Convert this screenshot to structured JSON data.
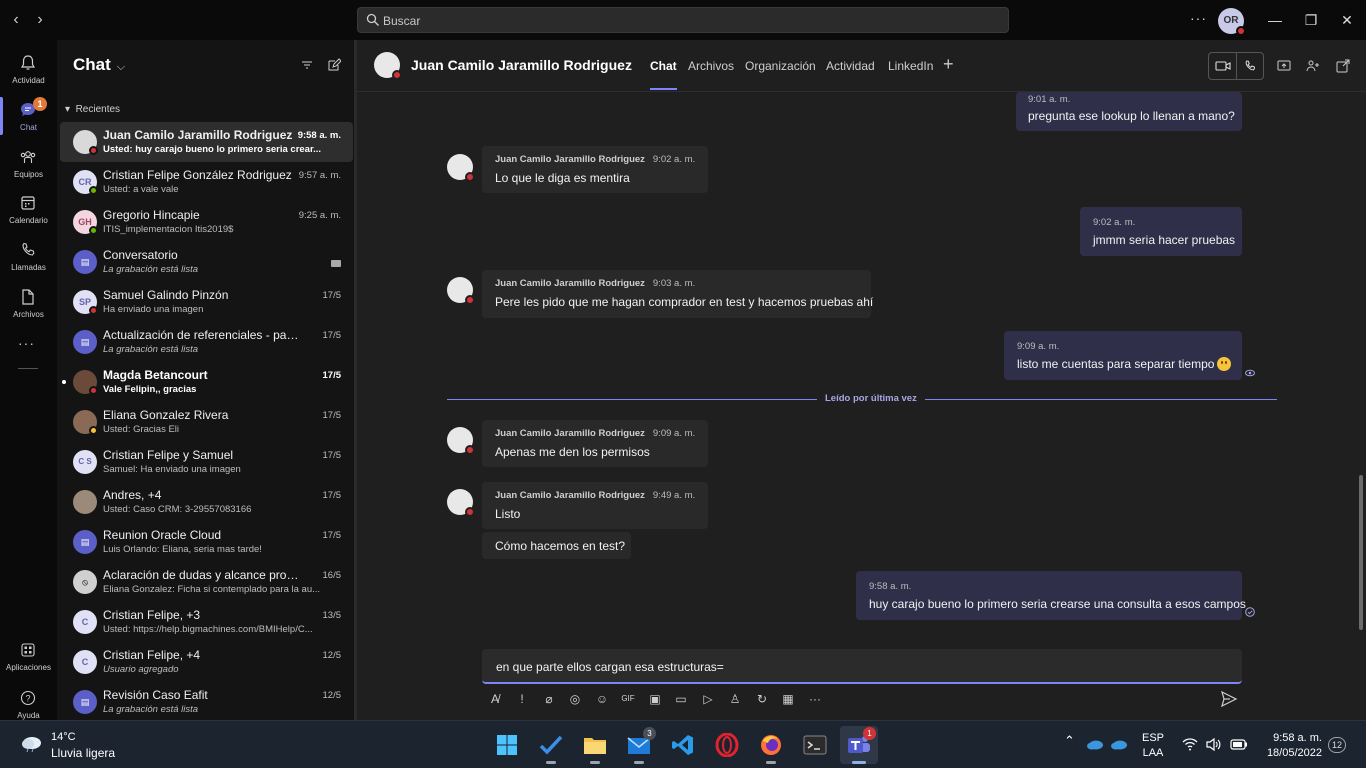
{
  "titlebar": {
    "search_placeholder": "Buscar",
    "more": "···",
    "avatar_initials": "OR"
  },
  "rail": {
    "items": [
      {
        "label": "Actividad",
        "icon": "bell-icon"
      },
      {
        "label": "Chat",
        "icon": "chat-icon",
        "badge": "1"
      },
      {
        "label": "Equipos",
        "icon": "teams-icon"
      },
      {
        "label": "Calendario",
        "icon": "calendar-icon"
      },
      {
        "label": "Llamadas",
        "icon": "phone-icon"
      },
      {
        "label": "Archivos",
        "icon": "file-icon"
      },
      {
        "label": "Aplicaciones",
        "icon": "apps-icon"
      },
      {
        "label": "Ayuda",
        "icon": "help-icon"
      }
    ],
    "more": "···"
  },
  "chatlist": {
    "title": "Chat",
    "section": "Recientes",
    "items": [
      {
        "name": "Juan Camilo Jaramillo Rodriguez",
        "preview": "Usted: huy carajo bueno lo primero seria crear...",
        "time": "9:58 a. m.",
        "initials": ""
      },
      {
        "name": "Cristian Felipe González Rodriguez",
        "preview": "Usted: a vale vale",
        "time": "9:57 a. m.",
        "initials": "CR"
      },
      {
        "name": "Gregorio Hincapie",
        "preview": "ITIS_implementacion Itis2019$",
        "time": "9:25 a. m.",
        "initials": "GH"
      },
      {
        "name": "Conversatorio",
        "preview": "La grabación está lista",
        "time": "",
        "initials": ""
      },
      {
        "name": "Samuel Galindo Pinzón",
        "preview": "Ha enviado una imagen",
        "time": "17/5",
        "initials": "SP"
      },
      {
        "name": "Actualización de referenciales - paso a ...",
        "preview": "La grabación está lista",
        "time": "17/5",
        "initials": ""
      },
      {
        "name": "Magda Betancourt",
        "preview": "Vale Felipin,, gracias",
        "time": "17/5",
        "initials": ""
      },
      {
        "name": "Eliana Gonzalez Rivera",
        "preview": "Usted: Gracias Eli",
        "time": "17/5",
        "initials": ""
      },
      {
        "name": "Cristian Felipe y Samuel",
        "preview": "Samuel: Ha enviado una imagen",
        "time": "17/5",
        "initials": "C S"
      },
      {
        "name": "Andres, +4",
        "preview": "Usted: Caso CRM: 3-29557083166",
        "time": "17/5",
        "initials": ""
      },
      {
        "name": "Reunion Oracle Cloud",
        "preview": "Luis Orlando: Eliana, seria mas tarde!",
        "time": "17/5",
        "initials": ""
      },
      {
        "name": "Aclaración de dudas y alcance propues...",
        "preview": "Eliana Gonzalez: Ficha si contemplado para la au...",
        "time": "16/5",
        "initials": ""
      },
      {
        "name": "Cristian Felipe, +3",
        "preview": "Usted: https://help.bigmachines.com/BMIHelp/C...",
        "time": "13/5",
        "initials": "C"
      },
      {
        "name": "Cristian Felipe, +4",
        "preview": "Usuario agregado",
        "time": "12/5",
        "initials": "C"
      },
      {
        "name": "Revisión Caso Eafit",
        "preview": "La grabación está lista",
        "time": "12/5",
        "initials": ""
      }
    ]
  },
  "conversation": {
    "contact": "Juan Camilo Jaramillo Rodriguez",
    "tabs": [
      "Chat",
      "Archivos",
      "Organización",
      "Actividad",
      "LinkedIn"
    ],
    "read_marker": "Leído por última vez",
    "messages": [
      {
        "from": "me",
        "time": "9:01 a. m.",
        "text": "pregunta ese lookup lo llenan a mano?"
      },
      {
        "from": "Juan Camilo Jaramillo Rodriguez",
        "time": "9:02 a. m.",
        "text": "Lo que le diga es mentira"
      },
      {
        "from": "me",
        "time": "9:02 a. m.",
        "text": "jmmm seria hacer pruebas"
      },
      {
        "from": "Juan Camilo Jaramillo Rodriguez",
        "time": "9:03 a. m.",
        "text": "Pere les pido que me hagan comprador en test y hacemos pruebas ahí"
      },
      {
        "from": "me",
        "time": "9:09 a. m.",
        "text": "listo me cuentas para separar tiempo"
      },
      {
        "from": "Juan Camilo Jaramillo Rodriguez",
        "time": "9:09 a. m.",
        "text": "Apenas me den los permisos"
      },
      {
        "from": "Juan Camilo Jaramillo Rodriguez",
        "time": "9:49 a. m.",
        "text": "Listo"
      },
      {
        "from": "Juan Camilo Jaramillo Rodriguez",
        "time": "",
        "text": "Cómo hacemos en test?"
      },
      {
        "from": "me",
        "time": "9:58 a. m.",
        "text": "huy carajo bueno lo primero seria crearse una consulta a esos campos"
      }
    ],
    "compose_value": "en que parte ellos cargan esa estructuras="
  },
  "taskbar": {
    "temperature": "14°C",
    "weather": "Lluvia ligera",
    "mail_badge": "3",
    "teams_badge": "1",
    "lang_top": "ESP",
    "lang_bottom": "LAA",
    "time": "9:58 a. m.",
    "date": "18/05/2022",
    "notifications": "12"
  },
  "colors": {
    "accent": "#7f85f5",
    "busy": "#d13438",
    "available": "#6bb700",
    "away": "#f8c33b",
    "my_bubble": "#2f2f4a",
    "their_bubble": "#292929"
  }
}
